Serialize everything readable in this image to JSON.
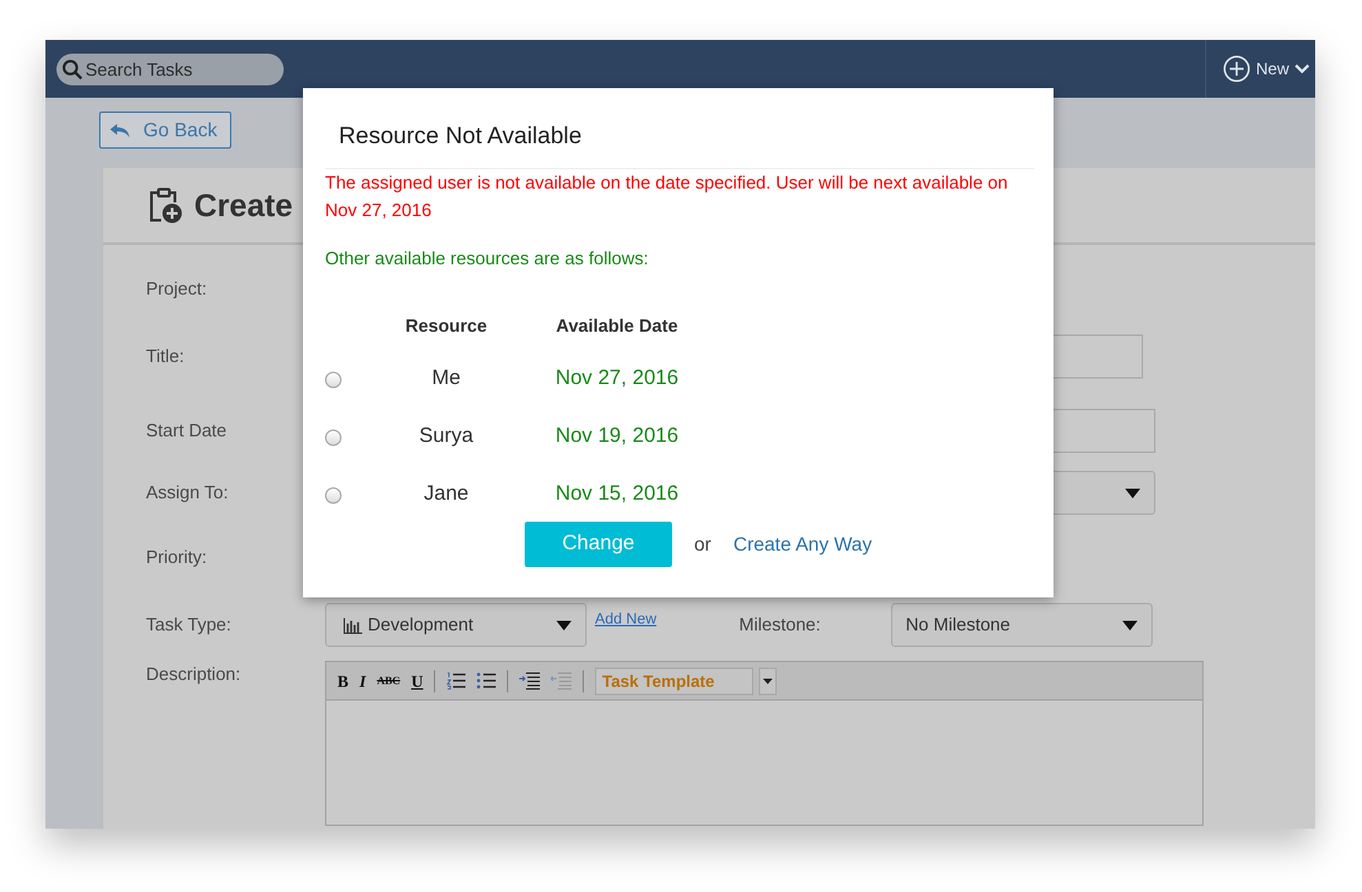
{
  "header": {
    "search": {
      "placeholder": "Search Tasks"
    },
    "new_button": "New"
  },
  "go_back": "Go Back",
  "form": {
    "title": "Create",
    "fields": [
      {
        "label": "Project:",
        "kind": "blank"
      },
      {
        "label": "Title:",
        "kind": "input"
      },
      {
        "label": "Start Date",
        "kind": "input"
      },
      {
        "label": "Assign To:",
        "kind": "select"
      },
      {
        "label": "Priority:",
        "kind": "blank"
      },
      {
        "label": "Task Type:",
        "kind": "tasktype",
        "value": "Development",
        "link": "Add New",
        "side_label": "Milestone:",
        "side_value": "No Milestone"
      },
      {
        "label": "Description:",
        "kind": "editor",
        "toolbar": [
          "B",
          "I",
          "ABC",
          "U"
        ],
        "template": "Task Template"
      }
    ]
  },
  "modal": {
    "title": "Resource Not Available",
    "error": "The assigned user is not available on the date specified. User will be next available on Nov 27, 2016",
    "info": "Other available resources are as follows:",
    "columns": [
      "Resource",
      "Available Date"
    ],
    "rows": [
      {
        "resource": "Me",
        "date": "Nov 27, 2016",
        "selected": false
      },
      {
        "resource": "Surya",
        "date": "Nov 19, 2016",
        "selected": false
      },
      {
        "resource": "Jane",
        "date": "Nov 15, 2016",
        "selected": false
      }
    ],
    "change_button": "Change",
    "or_text": "or",
    "link": "Create Any Way"
  }
}
